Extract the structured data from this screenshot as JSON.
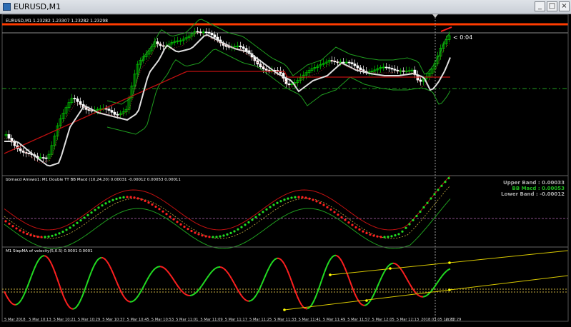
{
  "window": {
    "title": "EURUSD,M1",
    "buttons": [
      "_",
      "□",
      "×"
    ]
  },
  "main_chart": {
    "header": "EURUSD,M1  1.23282 1.23307 1.23282 1.23298",
    "countdown": "< 0:04",
    "colors": {
      "bull": "#00c800",
      "bear": "#ffffff",
      "red_line": "#ff3b00",
      "ma_fast": "#e0e0e0",
      "ma_slow": "#c01010",
      "band": "#1f9d1f"
    }
  },
  "indicator1": {
    "header": "bbmacd Amswo1: M1 Double TT BB Macd (10,24,20) 0.00031 -0.00012 0.00053 0.00011",
    "upper_band": "Upper Band : 0.00033",
    "bb_macd": "BB Macd : 0.00053",
    "lower_band": "Lower Band : -0.00012"
  },
  "indicator2": {
    "header": "M1 StepMA of velocity(5,0.5) 0.0001 0.0001"
  },
  "time_axis": [
    "5 Mar 2018",
    "5 Mar 10:13",
    "5 Mar 10:21",
    "5 Mar 10:29",
    "5 Mar 10:37",
    "5 Mar 10:45",
    "5 Mar 10:53",
    "5 Mar 11:01",
    "5 Mar 11:09",
    "5 Mar 11:17",
    "5 Mar 11:25",
    "5 Mar 11:33",
    "5 Mar 11:41",
    "5 Mar 11:49",
    "5 Mar 11:57",
    "5 Mar 12:05",
    "5 Mar 12:13",
    "2018.03.05 12:20",
    "ar 12:29"
  ]
}
